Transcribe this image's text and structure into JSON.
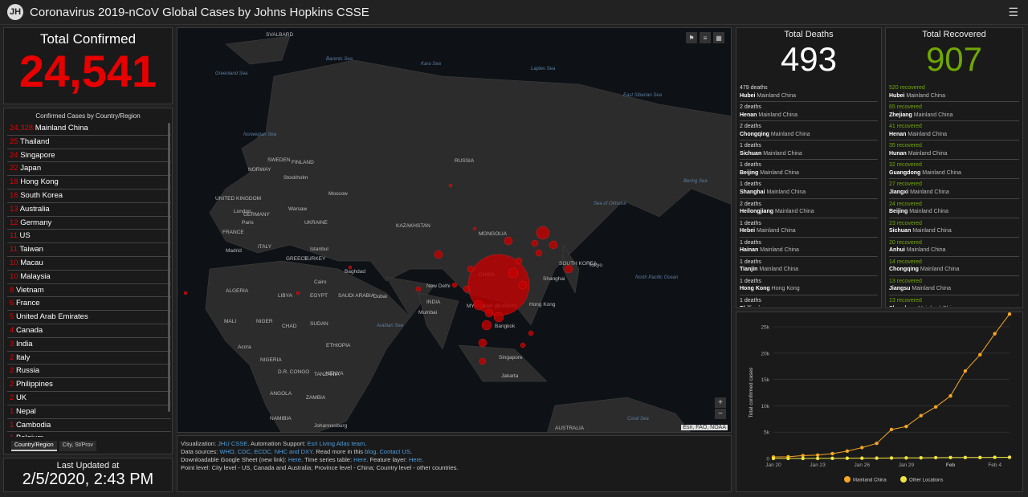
{
  "header": {
    "title": "Coronavirus 2019-nCoV Global Cases by Johns Hopkins CSSE",
    "logo": "JH"
  },
  "total_confirmed": {
    "label": "Total Confirmed",
    "value": "24,541"
  },
  "country_list": {
    "header": "Confirmed Cases by Country/Region",
    "items": [
      {
        "value": "24,328",
        "name": "Mainland China"
      },
      {
        "value": "25",
        "name": "Thailand"
      },
      {
        "value": "24",
        "name": "Singapore"
      },
      {
        "value": "22",
        "name": "Japan"
      },
      {
        "value": "18",
        "name": "Hong Kong"
      },
      {
        "value": "16",
        "name": "South Korea"
      },
      {
        "value": "13",
        "name": "Australia"
      },
      {
        "value": "12",
        "name": "Germany"
      },
      {
        "value": "11",
        "name": "US"
      },
      {
        "value": "11",
        "name": "Taiwan"
      },
      {
        "value": "10",
        "name": "Macau"
      },
      {
        "value": "10",
        "name": "Malaysia"
      },
      {
        "value": "8",
        "name": "Vietnam"
      },
      {
        "value": "6",
        "name": "France"
      },
      {
        "value": "5",
        "name": "United Arab Emirates"
      },
      {
        "value": "4",
        "name": "Canada"
      },
      {
        "value": "3",
        "name": "India"
      },
      {
        "value": "2",
        "name": "Italy"
      },
      {
        "value": "2",
        "name": "Russia"
      },
      {
        "value": "2",
        "name": "Philippines"
      },
      {
        "value": "2",
        "name": "UK"
      },
      {
        "value": "1",
        "name": "Nepal"
      },
      {
        "value": "1",
        "name": "Cambodia"
      },
      {
        "value": "1",
        "name": "Belgium"
      }
    ],
    "tabs": [
      "Country/Region",
      "City, St/Prov"
    ]
  },
  "last_updated": {
    "label": "Last Updated at",
    "value": "2/5/2020, 2:43 PM"
  },
  "map": {
    "attribution": "Esri, FAO, NOAA",
    "zoom_in": "+",
    "zoom_out": "−",
    "labels": [
      "SVALBARD",
      "Barents Sea",
      "Kara Sea",
      "Laptev Sea",
      "East Siberian Sea",
      "Greenland Sea",
      "Norwegian Sea",
      "SWEDEN",
      "FINLAND",
      "NORWAY",
      "Stockholm",
      "RUSSIA",
      "Bering Sea",
      "UNITED KINGDOM",
      "London",
      "Moscow",
      "Sea of Okhotsk",
      "Paris",
      "FRANCE",
      "GERMANY",
      "Warsaw",
      "UKRAINE",
      "KAZAKHSTAN",
      "MONGOLIA",
      "Madrid",
      "ITALY",
      "GREECE",
      "Istanbul",
      "TURKEY",
      "Tokyo",
      "SOUTH KOREA",
      "Shanghai",
      "North Pacific Ocean",
      "Baghdad",
      "CHINA",
      "New Delhi",
      "ALGERIA",
      "LIBYA",
      "EGYPT",
      "Cairo",
      "SAUDI ARABIA",
      "Dubai",
      "INDIA",
      "MYANMAR (BURMA)",
      "Hong Kong",
      "Mumbai",
      "MALI",
      "NIGER",
      "CHAD",
      "SUDAN",
      "Arabian Sea",
      "Bangkok",
      "NIGERIA",
      "ETHIOPIA",
      "Accra",
      "Singapore",
      "D.R. CONGO",
      "KENYA",
      "TANZANIA",
      "Jakarta",
      "ANGOLA",
      "ZAMBIA",
      "NAMIBIA",
      "Johannesburg",
      "Coral Sea",
      "AUSTRALIA"
    ]
  },
  "info": {
    "visualization": "Visualization:",
    "viz_link": "JHU CSSE",
    "automation": ". Automation Support:",
    "auto_link": "Esri Living Atlas team",
    "period": ".",
    "sources": "Data sources:",
    "sources_links": "WHO, CDC, ECDC, NHC and DXY",
    "read_more": ". Read more in this",
    "blog": "blog",
    "contact": "Contact US",
    "downloadable": "Downloadable Google Sheet (new link):",
    "here1": "Here",
    "ts": ". Time series table:",
    "here2": "Here",
    "fl": ". Feature layer:",
    "here3": "Here",
    "point_level": "Point level: City level - US, Canada and Australia; Province level - China; Country level - other countries."
  },
  "deaths": {
    "label": "Total Deaths",
    "value": "493",
    "items": [
      {
        "count": "479 deaths",
        "region": "Hubei",
        "country": "Mainland China"
      },
      {
        "count": "2 deaths",
        "region": "Henan",
        "country": "Mainland China"
      },
      {
        "count": "2 deaths",
        "region": "Chongqing",
        "country": "Mainland China"
      },
      {
        "count": "1 deaths",
        "region": "Sichuan",
        "country": "Mainland China"
      },
      {
        "count": "1 deaths",
        "region": "Beijing",
        "country": "Mainland China"
      },
      {
        "count": "1 deaths",
        "region": "Shanghai",
        "country": "Mainland China"
      },
      {
        "count": "2 deaths",
        "region": "Heilongjiang",
        "country": "Mainland China"
      },
      {
        "count": "1 deaths",
        "region": "Hebei",
        "country": "Mainland China"
      },
      {
        "count": "1 deaths",
        "region": "Hainan",
        "country": "Mainland China"
      },
      {
        "count": "1 deaths",
        "region": "Tianjin",
        "country": "Mainland China"
      },
      {
        "count": "1 deaths",
        "region": "Hong Kong",
        "country": "Hong Kong"
      },
      {
        "count": "1 deaths",
        "region": "Philippines",
        "country": ""
      }
    ]
  },
  "recovered": {
    "label": "Total Recovered",
    "value": "907",
    "items": [
      {
        "count": "520",
        "word": "recovered",
        "region": "Hubei",
        "country": "Mainland China"
      },
      {
        "count": "65",
        "word": "recovered",
        "region": "Zhejiang",
        "country": "Mainland China"
      },
      {
        "count": "41",
        "word": "recovered",
        "region": "Henan",
        "country": "Mainland China"
      },
      {
        "count": "35",
        "word": "recovered",
        "region": "Hunan",
        "country": "Mainland China"
      },
      {
        "count": "32",
        "word": "recovered",
        "region": "Guangdong",
        "country": "Mainland China"
      },
      {
        "count": "27",
        "word": "recovered",
        "region": "Jiangxi",
        "country": "Mainland China"
      },
      {
        "count": "24",
        "word": "recovered",
        "region": "Beijing",
        "country": "Mainland China"
      },
      {
        "count": "23",
        "word": "recovered",
        "region": "Sichuan",
        "country": "Mainland China"
      },
      {
        "count": "20",
        "word": "recovered",
        "region": "Anhui",
        "country": "Mainland China"
      },
      {
        "count": "14",
        "word": "recovered",
        "region": "Chongqing",
        "country": "Mainland China"
      },
      {
        "count": "13",
        "word": "recovered",
        "region": "Jiangsu",
        "country": "Mainland China"
      },
      {
        "count": "13",
        "word": "recovered",
        "region": "Shandong",
        "country": "Mainland China"
      }
    ]
  },
  "chart_data": {
    "type": "line",
    "ylabel": "Total confirmed cases",
    "ylim": [
      0,
      25000
    ],
    "yticks": [
      "0",
      "5k",
      "10k",
      "15k",
      "20k",
      "25k"
    ],
    "xticks": [
      "Jan 20",
      "Jan 23",
      "Jan 26",
      "Jan 29",
      "Feb",
      "Feb 4"
    ],
    "x": [
      "Jan 20",
      "Jan 21",
      "Jan 22",
      "Jan 23",
      "Jan 24",
      "Jan 25",
      "Jan 26",
      "Jan 27",
      "Jan 28",
      "Jan 29",
      "Jan 30",
      "Jan 31",
      "Feb 1",
      "Feb 2",
      "Feb 3",
      "Feb 4",
      "Feb 5"
    ],
    "series": [
      {
        "name": "Mainland China",
        "color": "#f5a623",
        "values": [
          278,
          326,
          547,
          639,
          916,
          1399,
          2062,
          2863,
          5494,
          6070,
          8124,
          9783,
          11871,
          16607,
          19693,
          23680,
          27409
        ]
      },
      {
        "name": "Other Locations",
        "color": "#f0e442",
        "values": [
          4,
          6,
          8,
          14,
          25,
          40,
          57,
          64,
          87,
          105,
          118,
          153,
          173,
          183,
          188,
          212,
          227
        ]
      }
    ]
  }
}
